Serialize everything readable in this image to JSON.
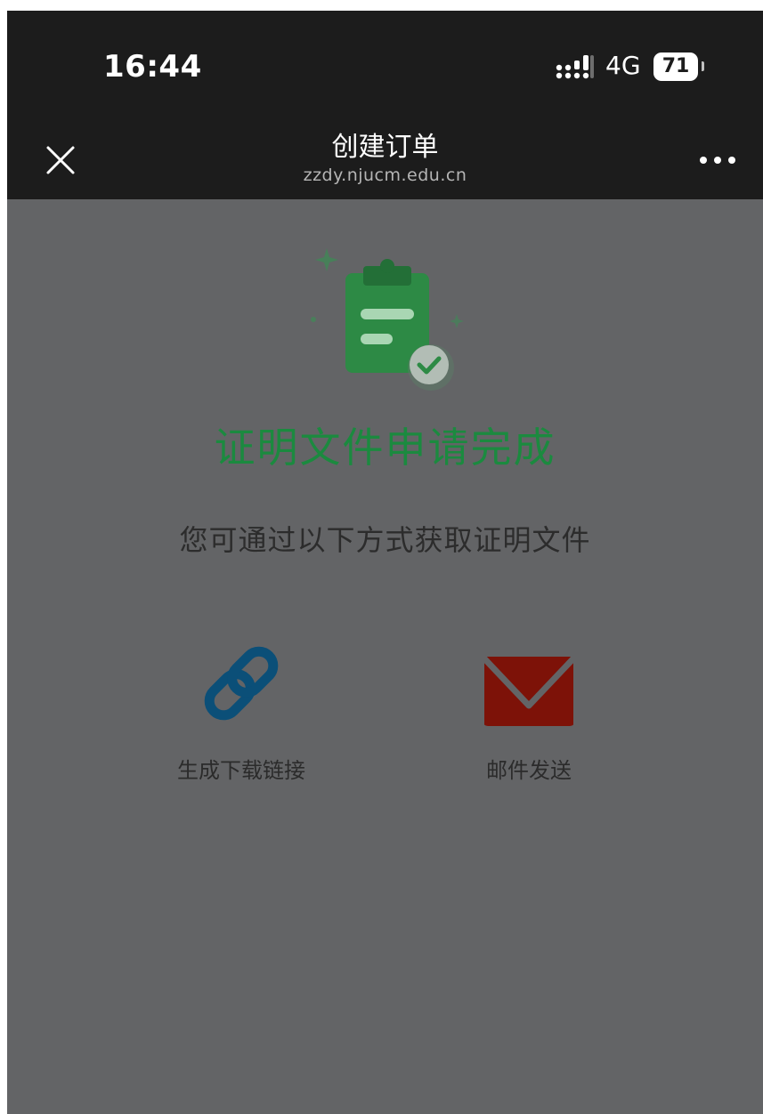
{
  "status_bar": {
    "time": "16:44",
    "network": "4G",
    "battery": "71"
  },
  "nav": {
    "title": "创建订单",
    "subtitle": "zzdy.njucm.edu.cn"
  },
  "result": {
    "title": "证明文件申请完成",
    "hint": "您可通过以下方式获取证明文件"
  },
  "options": [
    {
      "label": "生成下载链接",
      "icon": "link-icon",
      "color": "#0b4f78"
    },
    {
      "label": "邮件发送",
      "icon": "mail-icon",
      "color": "#7d1208"
    }
  ],
  "colors": {
    "success": "#1b8a3f",
    "overlay": "#636466",
    "topbar": "#1c1c1c"
  }
}
